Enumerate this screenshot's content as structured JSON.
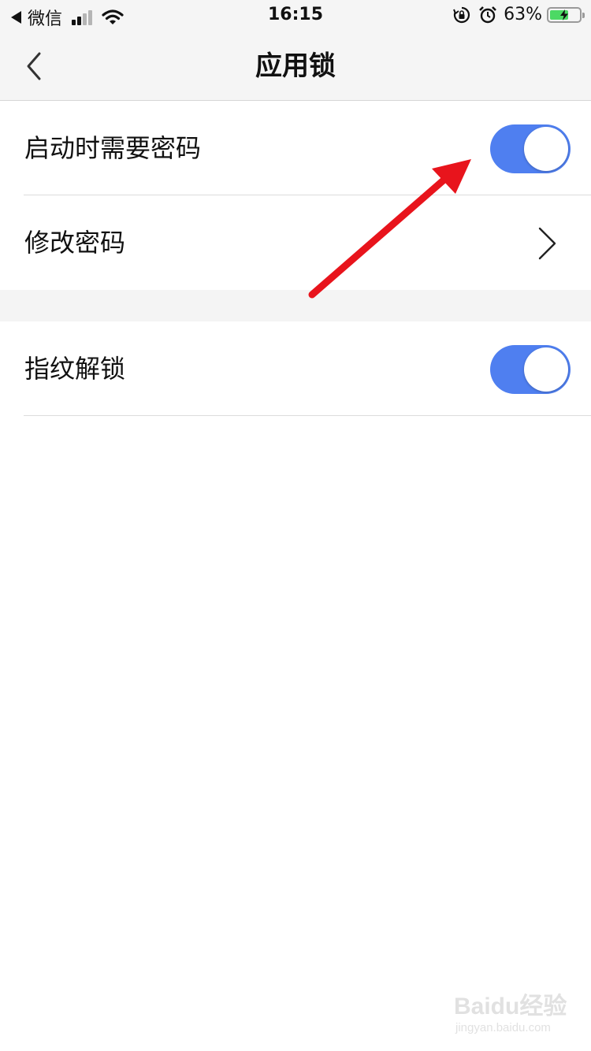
{
  "status_bar": {
    "back_app": "微信",
    "time": "16:15",
    "battery_percent": "63%",
    "battery_level": 0.63,
    "icons": [
      "back-triangle-icon",
      "signal-icon",
      "wifi-icon",
      "rotation-lock-icon",
      "alarm-icon",
      "battery-charging-icon"
    ]
  },
  "nav": {
    "title": "应用锁",
    "back_icon": "chevron-left-icon"
  },
  "settings": {
    "require_password": {
      "label": "启动时需要密码",
      "enabled": true
    },
    "change_password": {
      "label": "修改密码",
      "icon": "chevron-right-icon"
    },
    "fingerprint_unlock": {
      "label": "指纹解锁",
      "enabled": true
    }
  },
  "colors": {
    "toggle_on": "#4f7ff0",
    "annotation_arrow": "#e8141c",
    "battery_fill": "#4cd964"
  },
  "watermark": {
    "brand": "Baidu经验",
    "url": "jingyan.baidu.com"
  }
}
